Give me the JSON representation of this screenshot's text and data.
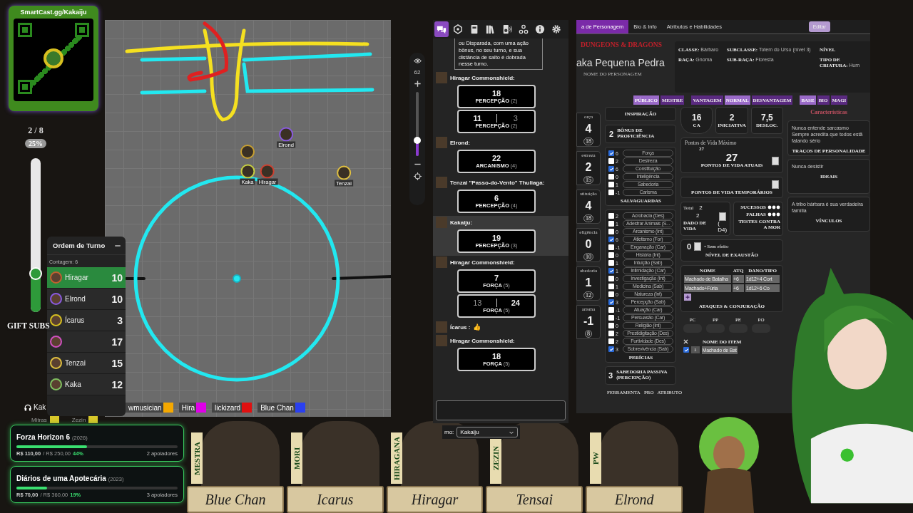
{
  "qr_panel": {
    "title": "SmartCast.gg/Kakaiju"
  },
  "sub_goal": {
    "count": "2 / 8",
    "percent": "25%",
    "level": 0.25,
    "label": "GIFT SUBS"
  },
  "map": {
    "tokens": [
      {
        "color": "#c8a030"
      },
      {
        "name": "Elrond",
        "color": "#8a5ae0"
      },
      {
        "name": "Kaka",
        "color": "#c8d040"
      },
      {
        "name": "Hiragar",
        "color": "#d04030"
      },
      {
        "name": "Tenzai",
        "color": "#e0c040"
      }
    ],
    "toolbar": {
      "zoom": "62",
      "level": 0.25
    }
  },
  "turn_order": {
    "title": "Ordem de Turno",
    "count": "Contagem: 6",
    "entries": [
      {
        "name": "Hiragar",
        "initiative": "10",
        "color": "#c06030",
        "selected": true
      },
      {
        "name": "Elrond",
        "initiative": "10",
        "color": "#8a5ae0",
        "selected": false
      },
      {
        "name": "Ícarus",
        "initiative": "3",
        "color": "#d8c020",
        "selected": false
      },
      {
        "initiative": "17",
        "color": "#d050c0",
        "selected": false
      },
      {
        "name": "Tenzai",
        "initiative": "15",
        "color": "#e0c040",
        "selected": false
      },
      {
        "name": "Kaka",
        "initiative": "12",
        "color": "#80c060",
        "selected": false
      }
    ]
  },
  "stream_tags": [
    {
      "name": "wmusician",
      "color": "#f5a800"
    },
    {
      "name": "Hira",
      "color": "#e000e8"
    },
    {
      "name": "lickizard",
      "color": "#e01010"
    },
    {
      "name": "Blue Chan",
      "color": "#2a40f0"
    }
  ],
  "voice": {
    "name": "Kak"
  },
  "viewer_tags": [
    {
      "name": "Mitras",
      "color": "#d8c82a"
    },
    {
      "name": "Zezin",
      "color": "#d8c82a"
    }
  ],
  "goals": [
    {
      "title": "Forza Horizon 6",
      "year": "(2026)",
      "raised": "R$ 110,00",
      "target": "/ R$ 250,00",
      "percent": "44%",
      "level": 0.44,
      "backers": "2 apoiadores"
    },
    {
      "title": "Diários de uma Apotecária",
      "year": "(2023)",
      "raised": "R$ 70,00",
      "target": "/ R$ 360,00",
      "percent": "19%",
      "level": 0.19,
      "backers": "3 apoiadores"
    }
  ],
  "chat": {
    "tabs": [
      {
        "kind": "chat",
        "selected": true
      },
      {
        "kind": "dice",
        "selected": false
      },
      {
        "kind": "book",
        "selected": false
      },
      {
        "kind": "library",
        "selected": false
      },
      {
        "kind": "speaker",
        "selected": false
      },
      {
        "kind": "network",
        "selected": false
      },
      {
        "kind": "info",
        "selected": false
      },
      {
        "kind": "settings",
        "selected": false
      }
    ],
    "messages": [
      {
        "kind": "note",
        "text": "ou Disparada, com uma ação bônus, no seu turno, e sua distância de salto é dobrada nesse turno."
      },
      {
        "kind": "roll",
        "sender": "Hiragar Commonshield:",
        "highlighted": false,
        "rolls": [
          {
            "kind": "single",
            "value": "18",
            "label": "PERCEPÇÃO",
            "mod": "(2)"
          },
          {
            "kind": "pair",
            "values": [
              {
                "value": "11",
                "kept": true
              },
              {
                "value": "3",
                "kept": false
              }
            ],
            "label": "PERCEPÇÃO",
            "mod": "(2)"
          }
        ]
      },
      {
        "kind": "roll",
        "sender": "Elrond:",
        "highlighted": false,
        "rolls": [
          {
            "kind": "single",
            "value": "22",
            "label": "ARCANISMO",
            "mod": "(4)"
          }
        ]
      },
      {
        "kind": "roll",
        "sender": "Tenzai \"Passo-do-Vento\" Thuliaga:",
        "highlighted": false,
        "rolls": [
          {
            "kind": "single",
            "value": "6",
            "label": "PERCEPÇÃO",
            "mod": "(4)"
          }
        ]
      },
      {
        "kind": "roll",
        "sender": "Kakaiju:",
        "highlighted": true,
        "rolls": [
          {
            "kind": "single",
            "value": "19",
            "label": "PERCEPÇÃO",
            "mod": "(3)"
          }
        ]
      },
      {
        "kind": "roll",
        "sender": "Hiragar Commonshield:",
        "highlighted": false,
        "rolls": [
          {
            "kind": "single",
            "value": "7",
            "label": "FORÇA",
            "mod": "(5)"
          },
          {
            "kind": "pair",
            "values": [
              {
                "value": "13",
                "kept": false
              },
              {
                "value": "24",
                "kept": true
              }
            ],
            "label": "FORÇA",
            "mod": "(5)"
          }
        ]
      },
      {
        "kind": "text",
        "sender": "Ícarus :",
        "text": "👍"
      },
      {
        "kind": "roll",
        "sender": "Hiragar Commonshield:",
        "highlighted": false,
        "rolls": [
          {
            "kind": "single",
            "value": "18",
            "label": "FORÇA",
            "mod": "(5)"
          }
        ]
      }
    ],
    "speaker_label": "mo:",
    "speaker": "Kakaiju"
  },
  "sheet": {
    "tabs": [
      {
        "label": "a de Personagem",
        "selected": true
      },
      {
        "label": "Bio & Info",
        "selected": false
      },
      {
        "label": "Atributos e Habilidades",
        "selected": false
      }
    ],
    "edit_button": "Editar",
    "logo": "DUNGEONS & DRAGONS",
    "name": "aka Pequena Pedra",
    "name_label": "NOME DO PERSONAGEM",
    "info": [
      {
        "label": "CLASSE:",
        "value": "Bárbaro"
      },
      {
        "label": "SUBCLASSE:",
        "value": "Totem do Urso (nível 3)"
      },
      {
        "label": "NÍVEL"
      },
      {
        "label": "RAÇA:",
        "value": "Gnoma"
      },
      {
        "label": "SUB-RAÇA:",
        "value": "Floresta"
      },
      {
        "label": "TIPO DE CRIATURA:",
        "value": "Hum"
      }
    ],
    "toggle_groups": [
      [
        {
          "label": "PÚBLICO",
          "selected": true
        },
        {
          "label": "MESTRE",
          "selected": false
        }
      ],
      [
        {
          "label": "VANTAGEM",
          "selected": false
        },
        {
          "label": "NORMAL",
          "selected": true
        },
        {
          "label": "DESVANTAGEM",
          "selected": false
        }
      ],
      [
        {
          "label": "BASE",
          "selected": true
        },
        {
          "label": "BIO",
          "selected": false
        },
        {
          "label": "MAGI",
          "selected": false
        }
      ]
    ],
    "abilities": [
      {
        "label": "orça",
        "modifier": "4",
        "score": "18"
      },
      {
        "label": "estreza",
        "modifier": "2",
        "score": "15"
      },
      {
        "label": "stituição",
        "modifier": "4",
        "score": "18"
      },
      {
        "label": "eligência",
        "modifier": "0",
        "score": "10"
      },
      {
        "label": "abedoria",
        "modifier": "1",
        "score": "12"
      },
      {
        "label": "arisma",
        "modifier": "-1",
        "score": "8"
      }
    ],
    "inspiration": "INSPIRAÇÃO",
    "proficiency": {
      "value": "2",
      "label": "BÔNUS DE PROFICIÊNCIA"
    },
    "saves": [
      {
        "value": "6",
        "label": "Força",
        "checked": true
      },
      {
        "value": "2",
        "label": "Destreza",
        "checked": false
      },
      {
        "value": "6",
        "label": "Constituição",
        "checked": true
      },
      {
        "value": "0",
        "label": "Inteligência",
        "checked": false
      },
      {
        "value": "1",
        "label": "Sabedoria",
        "checked": false
      },
      {
        "value": "-1",
        "label": "Carisma",
        "checked": false
      }
    ],
    "saves_title": "SALVAGUARDAS",
    "skills": [
      {
        "value": "2",
        "label": "Acrobacia (Des)",
        "checked": false
      },
      {
        "value": "1",
        "label": "Adestrar Animais (S...",
        "checked": false
      },
      {
        "value": "0",
        "label": "Arcanismo (Int)",
        "checked": false
      },
      {
        "value": "6",
        "label": "Atletismo (For)",
        "checked": true
      },
      {
        "value": "-1",
        "label": "Enganação (Car)",
        "checked": false
      },
      {
        "value": "0",
        "label": "História (Int)",
        "checked": false
      },
      {
        "value": "1",
        "label": "Intuição (Sab)",
        "checked": false
      },
      {
        "value": "1",
        "label": "Intimidação (Car)",
        "checked": true
      },
      {
        "value": "0",
        "label": "Investigação (Int)",
        "checked": false
      },
      {
        "value": "1",
        "label": "Medicina (Sab)",
        "checked": false
      },
      {
        "value": "0",
        "label": "Natureza (Int)",
        "checked": false
      },
      {
        "value": "3",
        "label": "Percepção (Sab)",
        "checked": true
      },
      {
        "value": "-1",
        "label": "Atuação (Car)",
        "checked": false
      },
      {
        "value": "-1",
        "label": "Persuasão (Car)",
        "checked": false
      },
      {
        "value": "0",
        "label": "Religião (Int)",
        "checked": false
      },
      {
        "value": "2",
        "label": "Prestidigitação (Des)",
        "checked": false
      },
      {
        "value": "2",
        "label": "Furtividade (Des)",
        "checked": false
      },
      {
        "value": "3",
        "label": "Sobrevivência (Sab)",
        "checked": true
      }
    ],
    "skills_title": "PERÍCIAS",
    "passive": {
      "value": "3",
      "label": "SABEDORIA PASSIVA (PERCEPÇÃO)"
    },
    "tools_columns": [
      "FERRAMENTA",
      "PRO",
      "ATRIBUTO"
    ],
    "stats": [
      {
        "value": "16",
        "label": "CA"
      },
      {
        "value": "2",
        "label": "INICIATIVA"
      },
      {
        "value": "7,5",
        "label": "DESLOC."
      }
    ],
    "hp": {
      "max_label": "Pontos de Vida Máximo",
      "max": "27",
      "current": "27",
      "current_label": "PONTOS DE VIDA ATUAIS",
      "temp_label": "PONTOS DE VIDA TEMPORÁRIOS"
    },
    "hit_dice": {
      "total_label": "Total",
      "total": "2",
      "value": "2",
      "label": "DADO DE VIDA",
      "die": "( D4)"
    },
    "death_saves": {
      "successes": "SUCESSOS",
      "failures": "FALHAS",
      "label": "TESTES CONTRA A MOR"
    },
    "exhaustion": {
      "value": "0",
      "effect": "• Sem efeito",
      "label": "NÍVEL DE EXAUSTÃO"
    },
    "attacks": {
      "columns": [
        "NOME",
        "ATQ",
        "DANO/TIPO"
      ],
      "rows": [
        [
          "Machado de Batalha",
          "+6",
          "1d12+4 Cort"
        ],
        [
          "Machado+Fúria",
          "+6",
          "1d12+6 Co"
        ]
      ],
      "title": "ATAQUES & CONJURAÇÃO"
    },
    "coins": [
      "PC",
      "PP",
      "PE",
      "PO"
    ],
    "items": {
      "header": "NOME DO ITEM",
      "rows": [
        {
          "checked": true,
          "qty": "1",
          "name": "Machado de Bat"
        }
      ]
    },
    "characteristics": {
      "title": "Características",
      "blocks": [
        {
          "text": "Nunca entende sarcasmo\nSempre acredita que todos estã\nfalando sério",
          "label": "TRAÇOS DE PERSONALIDADE"
        },
        {
          "text": "Nunca desistir",
          "label": "IDEAIS"
        },
        {
          "text": "A tribo bárbara é sua verdadeira\nfamília",
          "label": "VÍNCULOS"
        }
      ]
    }
  },
  "party": [
    {
      "player": "MESTRA",
      "character": "Blue Chan"
    },
    {
      "player": "MORI",
      "character": "Icarus"
    },
    {
      "player": "HIRAGANA",
      "character": "Hiragar"
    },
    {
      "player": "ZEZIN",
      "character": "Tensai"
    },
    {
      "player": "PW",
      "character": "Elrond"
    }
  ]
}
